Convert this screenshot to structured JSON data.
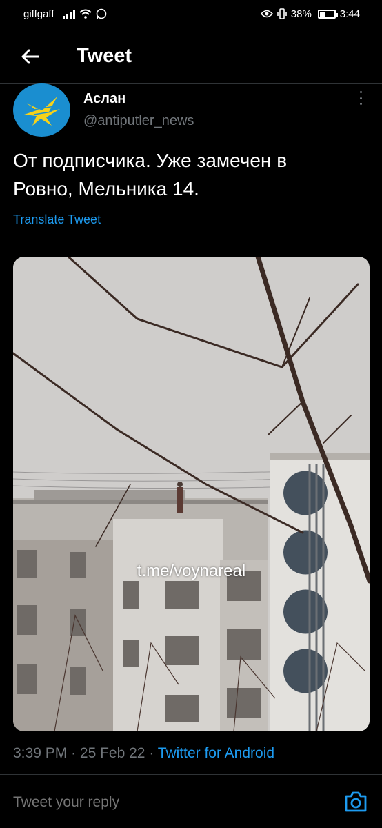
{
  "status_bar": {
    "carrier": "giffgaff",
    "battery_percent": "38%",
    "battery_level": 0.38,
    "time": "3:44",
    "icons": [
      "signal-icon",
      "wifi-icon",
      "whatsapp-icon",
      "eye-icon",
      "vibrate-icon",
      "battery-icon"
    ]
  },
  "header": {
    "title": "Tweet",
    "back_icon": "back-arrow-icon"
  },
  "tweet": {
    "author_name": "Аслан",
    "author_handle": "@antiputler_news",
    "text": "От подписчика. Уже замечен в\nРовно, Мельника 14.",
    "translate_label": "Translate Tweet",
    "media_watermark": "t.me/voynareal",
    "time": "3:39 PM",
    "separator": "·",
    "date": "25 Feb 22",
    "source": "Twitter for Android"
  },
  "reply": {
    "placeholder": "Tweet your reply",
    "camera_icon": "camera-icon"
  },
  "colors": {
    "background": "#000000",
    "accent": "#1d9bf0",
    "secondary_text": "#71767b",
    "divider": "#2f3336",
    "avatar_bg": "#1a8ed0",
    "avatar_emblem": "#f6d21a"
  }
}
